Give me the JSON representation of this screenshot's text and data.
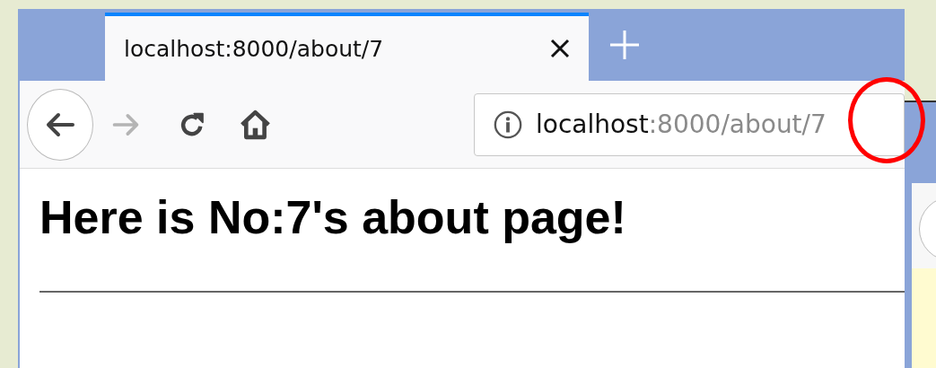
{
  "tabs": [
    {
      "label": "localhost:8000/about/7",
      "selected": true
    }
  ],
  "toolbar": {
    "back_disabled": false,
    "forward_disabled": true
  },
  "address_bar": {
    "host": "localhost",
    "path": ":8000/about/7"
  },
  "page": {
    "heading": "Here is No:7's about page!"
  },
  "annotation": {
    "kind": "circle"
  }
}
